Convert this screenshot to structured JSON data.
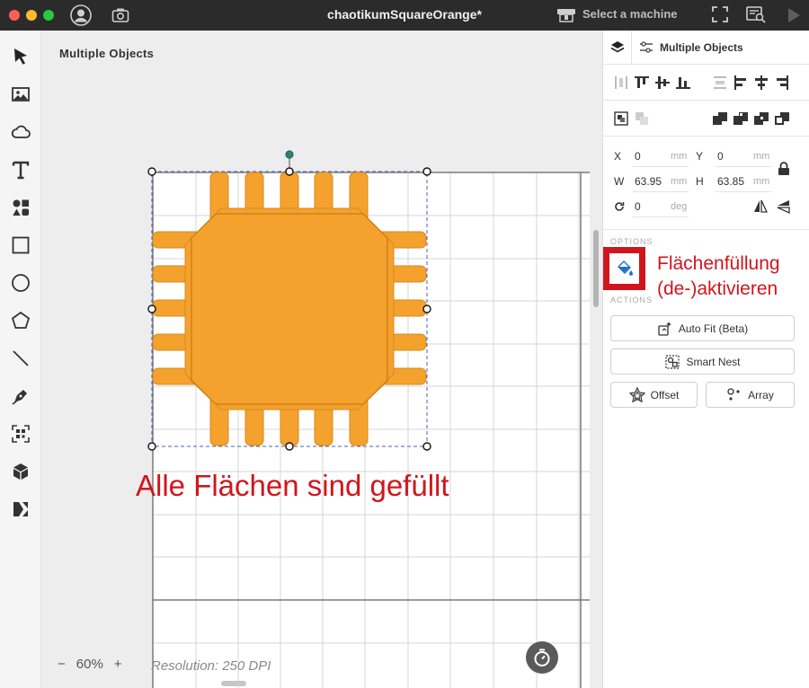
{
  "window": {
    "title": "chaotikumSquareOrange*",
    "machine_label": "Select a machine"
  },
  "colors": {
    "accent": "#f4a12d",
    "accent_dark": "#d98a1a",
    "annotation": "#d0161c",
    "titlebar": "#2b2b2b"
  },
  "toolbar": {
    "icons": [
      "select-icon",
      "image-icon",
      "cloud-icon",
      "text-icon",
      "shapes-icon",
      "rectangle-icon",
      "ellipse-icon",
      "polygon-icon",
      "line-icon",
      "pen-icon",
      "qr-code-icon",
      "3d-box-icon",
      "design-space-icon"
    ]
  },
  "canvas": {
    "title": "Multiple Objects",
    "zoom_minus": "−",
    "zoom_value": "60%",
    "zoom_plus": "+",
    "resolution": "Resolution: 250 DPI"
  },
  "panel": {
    "title": "Multiple Objects",
    "x_label": "X",
    "x_value": "0",
    "x_unit": "mm",
    "y_label": "Y",
    "y_value": "0",
    "y_unit": "mm",
    "w_label": "W",
    "w_value": "63.95",
    "w_unit": "mm",
    "h_label": "H",
    "h_value": "63.85",
    "h_unit": "mm",
    "rot_value": "0",
    "rot_unit": "deg",
    "options_label": "OPTIONS",
    "actions_label": "ACTIONS",
    "auto_fit": "Auto Fit (Beta)",
    "smart_nest": "Smart Nest",
    "offset": "Offset",
    "array": "Array"
  },
  "annotations": {
    "fill_toggle_line1": "Flächenfüllung",
    "fill_toggle_line2": "(de-)aktivieren",
    "bottom": "Alle Flächen sind gefüllt"
  }
}
